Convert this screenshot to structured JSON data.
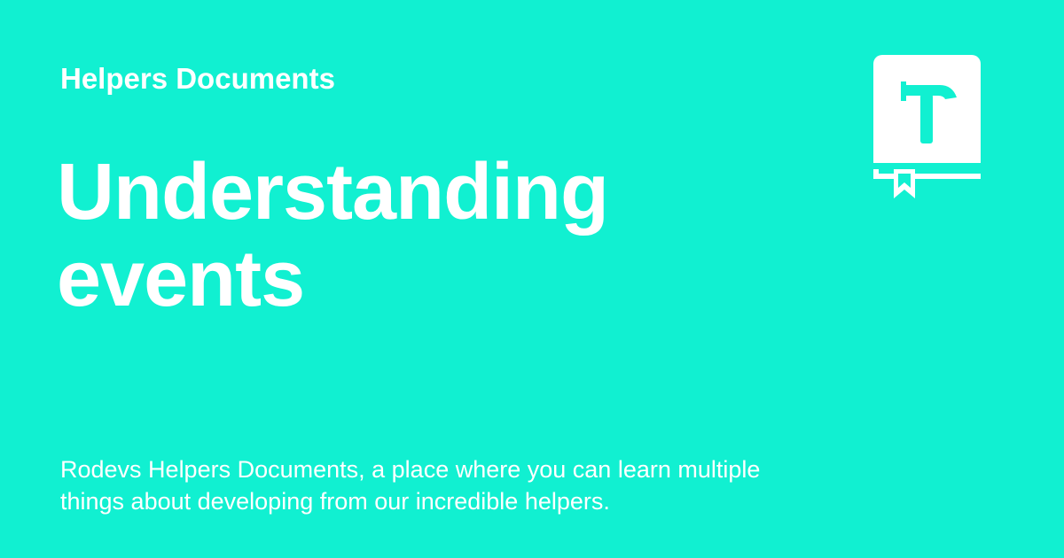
{
  "header": {
    "site_name": "Helpers Documents"
  },
  "main": {
    "title_lines": [
      "Understanding",
      "events"
    ],
    "description_lines": [
      "Rodevs Helpers Documents, a place where you can learn multiple",
      "things about developing from our incredible helpers."
    ]
  },
  "logo": {
    "icon": "book-hammer-icon"
  },
  "colors": {
    "background": "#11f0d1",
    "text": "#ffffff"
  }
}
